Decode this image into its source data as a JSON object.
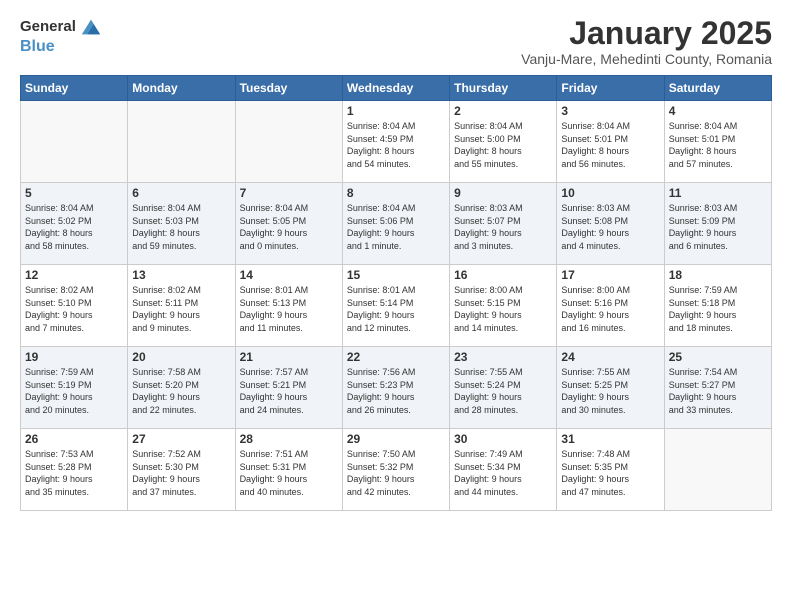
{
  "logo": {
    "line1": "General",
    "line2": "Blue"
  },
  "title": "January 2025",
  "subtitle": "Vanju-Mare, Mehedinti County, Romania",
  "weekdays": [
    "Sunday",
    "Monday",
    "Tuesday",
    "Wednesday",
    "Thursday",
    "Friday",
    "Saturday"
  ],
  "weeks": [
    [
      {
        "day": "",
        "sunrise": "",
        "sunset": "",
        "daylight": ""
      },
      {
        "day": "",
        "sunrise": "",
        "sunset": "",
        "daylight": ""
      },
      {
        "day": "",
        "sunrise": "",
        "sunset": "",
        "daylight": ""
      },
      {
        "day": "1",
        "sunrise": "Sunrise: 8:04 AM",
        "sunset": "Sunset: 4:59 PM",
        "daylight": "Daylight: 8 hours and 54 minutes."
      },
      {
        "day": "2",
        "sunrise": "Sunrise: 8:04 AM",
        "sunset": "Sunset: 5:00 PM",
        "daylight": "Daylight: 8 hours and 55 minutes."
      },
      {
        "day": "3",
        "sunrise": "Sunrise: 8:04 AM",
        "sunset": "Sunset: 5:01 PM",
        "daylight": "Daylight: 8 hours and 56 minutes."
      },
      {
        "day": "4",
        "sunrise": "Sunrise: 8:04 AM",
        "sunset": "Sunset: 5:01 PM",
        "daylight": "Daylight: 8 hours and 57 minutes."
      }
    ],
    [
      {
        "day": "5",
        "sunrise": "Sunrise: 8:04 AM",
        "sunset": "Sunset: 5:02 PM",
        "daylight": "Daylight: 8 hours and 58 minutes."
      },
      {
        "day": "6",
        "sunrise": "Sunrise: 8:04 AM",
        "sunset": "Sunset: 5:03 PM",
        "daylight": "Daylight: 8 hours and 59 minutes."
      },
      {
        "day": "7",
        "sunrise": "Sunrise: 8:04 AM",
        "sunset": "Sunset: 5:05 PM",
        "daylight": "Daylight: 9 hours and 0 minutes."
      },
      {
        "day": "8",
        "sunrise": "Sunrise: 8:04 AM",
        "sunset": "Sunset: 5:06 PM",
        "daylight": "Daylight: 9 hours and 1 minute."
      },
      {
        "day": "9",
        "sunrise": "Sunrise: 8:03 AM",
        "sunset": "Sunset: 5:07 PM",
        "daylight": "Daylight: 9 hours and 3 minutes."
      },
      {
        "day": "10",
        "sunrise": "Sunrise: 8:03 AM",
        "sunset": "Sunset: 5:08 PM",
        "daylight": "Daylight: 9 hours and 4 minutes."
      },
      {
        "day": "11",
        "sunrise": "Sunrise: 8:03 AM",
        "sunset": "Sunset: 5:09 PM",
        "daylight": "Daylight: 9 hours and 6 minutes."
      }
    ],
    [
      {
        "day": "12",
        "sunrise": "Sunrise: 8:02 AM",
        "sunset": "Sunset: 5:10 PM",
        "daylight": "Daylight: 9 hours and 7 minutes."
      },
      {
        "day": "13",
        "sunrise": "Sunrise: 8:02 AM",
        "sunset": "Sunset: 5:11 PM",
        "daylight": "Daylight: 9 hours and 9 minutes."
      },
      {
        "day": "14",
        "sunrise": "Sunrise: 8:01 AM",
        "sunset": "Sunset: 5:13 PM",
        "daylight": "Daylight: 9 hours and 11 minutes."
      },
      {
        "day": "15",
        "sunrise": "Sunrise: 8:01 AM",
        "sunset": "Sunset: 5:14 PM",
        "daylight": "Daylight: 9 hours and 12 minutes."
      },
      {
        "day": "16",
        "sunrise": "Sunrise: 8:00 AM",
        "sunset": "Sunset: 5:15 PM",
        "daylight": "Daylight: 9 hours and 14 minutes."
      },
      {
        "day": "17",
        "sunrise": "Sunrise: 8:00 AM",
        "sunset": "Sunset: 5:16 PM",
        "daylight": "Daylight: 9 hours and 16 minutes."
      },
      {
        "day": "18",
        "sunrise": "Sunrise: 7:59 AM",
        "sunset": "Sunset: 5:18 PM",
        "daylight": "Daylight: 9 hours and 18 minutes."
      }
    ],
    [
      {
        "day": "19",
        "sunrise": "Sunrise: 7:59 AM",
        "sunset": "Sunset: 5:19 PM",
        "daylight": "Daylight: 9 hours and 20 minutes."
      },
      {
        "day": "20",
        "sunrise": "Sunrise: 7:58 AM",
        "sunset": "Sunset: 5:20 PM",
        "daylight": "Daylight: 9 hours and 22 minutes."
      },
      {
        "day": "21",
        "sunrise": "Sunrise: 7:57 AM",
        "sunset": "Sunset: 5:21 PM",
        "daylight": "Daylight: 9 hours and 24 minutes."
      },
      {
        "day": "22",
        "sunrise": "Sunrise: 7:56 AM",
        "sunset": "Sunset: 5:23 PM",
        "daylight": "Daylight: 9 hours and 26 minutes."
      },
      {
        "day": "23",
        "sunrise": "Sunrise: 7:55 AM",
        "sunset": "Sunset: 5:24 PM",
        "daylight": "Daylight: 9 hours and 28 minutes."
      },
      {
        "day": "24",
        "sunrise": "Sunrise: 7:55 AM",
        "sunset": "Sunset: 5:25 PM",
        "daylight": "Daylight: 9 hours and 30 minutes."
      },
      {
        "day": "25",
        "sunrise": "Sunrise: 7:54 AM",
        "sunset": "Sunset: 5:27 PM",
        "daylight": "Daylight: 9 hours and 33 minutes."
      }
    ],
    [
      {
        "day": "26",
        "sunrise": "Sunrise: 7:53 AM",
        "sunset": "Sunset: 5:28 PM",
        "daylight": "Daylight: 9 hours and 35 minutes."
      },
      {
        "day": "27",
        "sunrise": "Sunrise: 7:52 AM",
        "sunset": "Sunset: 5:30 PM",
        "daylight": "Daylight: 9 hours and 37 minutes."
      },
      {
        "day": "28",
        "sunrise": "Sunrise: 7:51 AM",
        "sunset": "Sunset: 5:31 PM",
        "daylight": "Daylight: 9 hours and 40 minutes."
      },
      {
        "day": "29",
        "sunrise": "Sunrise: 7:50 AM",
        "sunset": "Sunset: 5:32 PM",
        "daylight": "Daylight: 9 hours and 42 minutes."
      },
      {
        "day": "30",
        "sunrise": "Sunrise: 7:49 AM",
        "sunset": "Sunset: 5:34 PM",
        "daylight": "Daylight: 9 hours and 44 minutes."
      },
      {
        "day": "31",
        "sunrise": "Sunrise: 7:48 AM",
        "sunset": "Sunset: 5:35 PM",
        "daylight": "Daylight: 9 hours and 47 minutes."
      },
      {
        "day": "",
        "sunrise": "",
        "sunset": "",
        "daylight": ""
      }
    ]
  ],
  "shaded_rows": [
    1,
    3
  ]
}
